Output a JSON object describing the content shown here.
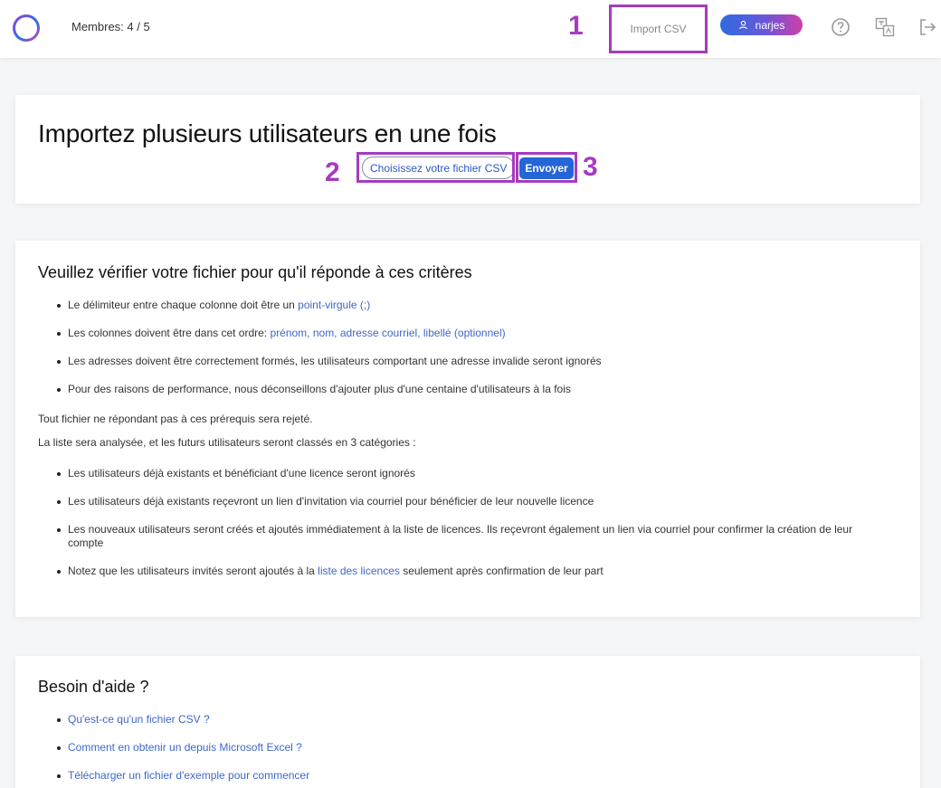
{
  "header": {
    "members_label": "Membres: 4 / 5",
    "import_csv_label": "Import CSV",
    "user_name": "narjes"
  },
  "annotations": {
    "one": "1",
    "two": "2",
    "three": "3"
  },
  "import_section": {
    "title": "Importez plusieurs utilisateurs en une fois",
    "choose_file_label": "Choisissez votre fichier CSV",
    "send_label": "Envoyer"
  },
  "criteria": {
    "title": "Veuillez vérifier votre fichier pour qu'il réponde à ces critères",
    "items": [
      {
        "text": "Le délimiteur entre chaque colonne doit être un ",
        "link": "point-virgule (;)"
      },
      {
        "text": "Les colonnes doivent être dans cet ordre: ",
        "link": "prénom, nom, adresse courriel, libellé (optionnel)"
      },
      {
        "text": "Les adresses doivent être correctement formés, les utilisateurs comportant une adresse invalide seront ignorés",
        "link": ""
      },
      {
        "text": "Pour des raisons de performance, nous déconseillons d'ajouter plus d'une centaine d'utilisateurs à la fois",
        "link": ""
      }
    ],
    "reject_note": "Tout fichier ne répondant pas à ces prérequis sera rejeté.",
    "analysis_note": "La liste sera analysée, et les futurs utilisateurs seront classés en 3 catégories :",
    "categories": [
      "Les utilisateurs déjà existants et bénéficiant d'une licence seront ignorés",
      "Les utilisateurs déjà existants reçevront un lien d'invitation via courriel pour bénéficier de leur nouvelle licence",
      "Les nouveaux utilisateurs seront créés et ajoutés immédiatement à la liste de licences. Ils reçevront également un lien via courriel pour confirmer la création de leur compte"
    ],
    "last_item_before": "Notez que les utilisateurs invités seront ajoutés à la ",
    "last_item_link": "liste des licences",
    "last_item_after": " seulement après confirmation de leur part"
  },
  "help": {
    "title": "Besoin d'aide ?",
    "links": [
      "Qu'est-ce qu'un fichier CSV ?",
      "Comment en obtenir un depuis Microsoft Excel ?",
      "Télécharger un fichier d'exemple pour commencer"
    ]
  },
  "colors": {
    "annotation": "#a63bbf",
    "link": "#3f67c8",
    "primary": "#2466d6"
  },
  "icons": [
    "help-icon",
    "translate-icon",
    "logout-icon",
    "user-icon"
  ]
}
